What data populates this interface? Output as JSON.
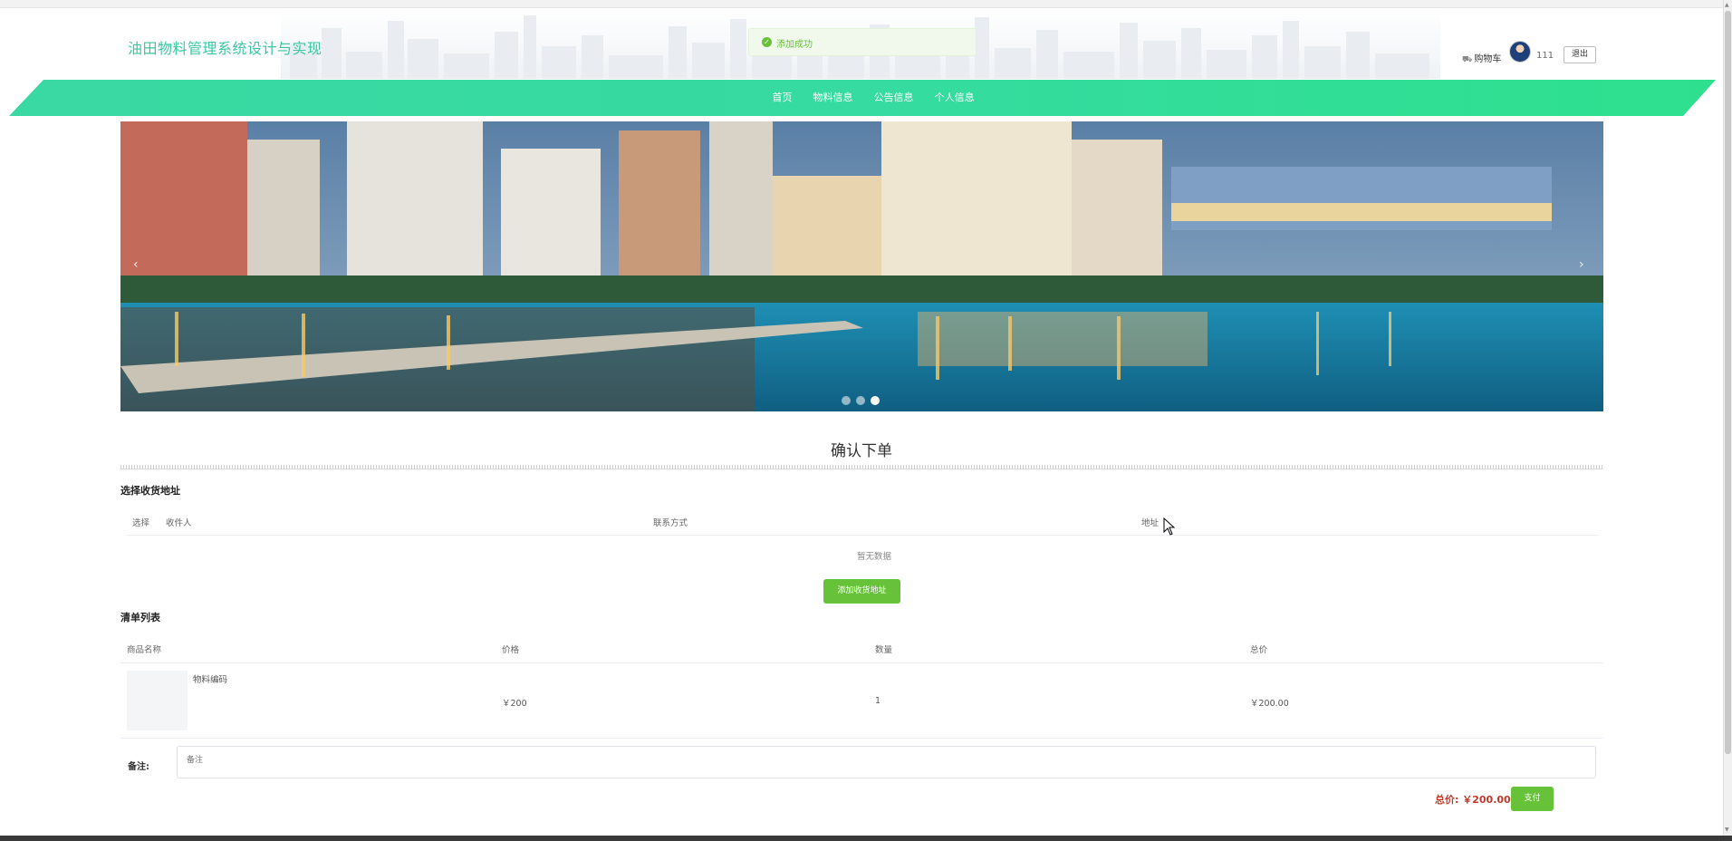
{
  "header": {
    "site_title": "油田物料管理系统设计与实现",
    "toast_message": "添加成功",
    "cart_label": "购物车",
    "cart_icon": "cart-icon",
    "username": "111",
    "logout_label": "退出"
  },
  "nav": {
    "items": [
      {
        "label": "首页"
      },
      {
        "label": "物料信息"
      },
      {
        "label": "公告信息"
      },
      {
        "label": "个人信息"
      }
    ]
  },
  "carousel": {
    "prev_icon": "‹",
    "next_icon": "›",
    "slide_count": 3,
    "active_slide": 3
  },
  "order": {
    "page_heading": "确认下单",
    "address_section_title": "选择收货地址",
    "address_columns": {
      "select": "选择",
      "recipient": "收件人",
      "contact": "联系方式",
      "address": "地址"
    },
    "address_empty_text": "暂无数据",
    "add_address_label": "添加收货地址",
    "list_section_title": "清单列表",
    "item_columns": {
      "name": "商品名称",
      "price": "价格",
      "quantity": "数量",
      "total": "总价"
    },
    "items": [
      {
        "name": "物料编码",
        "price": "￥200",
        "quantity": "1",
        "total": "￥200.00"
      }
    ],
    "remark_label": "备注:",
    "remark_placeholder": "备注",
    "total_label": "总价: ￥200.00",
    "pay_label": "支付"
  },
  "colors": {
    "brand_green": "#3cc6a0",
    "nav_gradient_start": "#3ad8a3",
    "nav_gradient_end": "#2ee08e",
    "button_green": "#67c23a",
    "price_red": "#c0392b"
  }
}
